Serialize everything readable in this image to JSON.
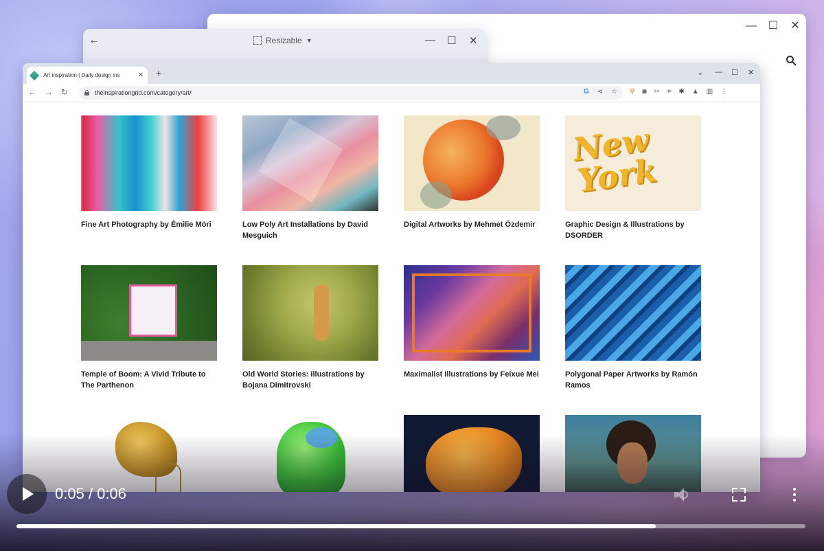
{
  "back_window": {
    "controls": {
      "minimize": "—",
      "maximize": "☐",
      "close": "✕"
    },
    "search_icon": "search-icon"
  },
  "mid_window": {
    "back_icon": "←",
    "resize_label": "Resizable",
    "resize_caret": "▼",
    "controls": {
      "minimize": "—",
      "maximize": "☐",
      "close": "✕"
    }
  },
  "browser": {
    "tab": {
      "title": "Art inspiration | Daily design ins",
      "close": "✕"
    },
    "new_tab": "+",
    "window_controls": {
      "chevron": "⌄",
      "minimize": "—",
      "maximize": "☐",
      "close": "✕"
    },
    "nav": {
      "back": "←",
      "forward": "→",
      "reload": "↻"
    },
    "url": "theinspirationgrid.com/category/art/",
    "omnibox_icons": [
      "G",
      "⋖",
      "☆"
    ],
    "extension_icons": [
      "⚲",
      "◙",
      "✂",
      "⌗",
      "✱",
      "▲",
      "▥",
      "⋮"
    ]
  },
  "cards": [
    {
      "title": "Fine Art Photography by Émilie Möri"
    },
    {
      "title": "Low Poly Art Installations by David Mesguich"
    },
    {
      "title": "Digital Artworks by Mehmet Özdemir"
    },
    {
      "title": "Graphic Design & Illustrations by DSORDER",
      "thumb_text": "New York"
    },
    {
      "title": "Temple of Boom: A Vivid Tribute to The Parthenon"
    },
    {
      "title": "Old World Stories: Illustrations by Bojana Dimitrovski"
    },
    {
      "title": "Maximalist Illustrations by Feixue Mei"
    },
    {
      "title": "Polygonal Paper Artworks by Ramón Ramos"
    },
    {
      "title": ""
    },
    {
      "title": ""
    },
    {
      "title": ""
    },
    {
      "title": ""
    }
  ],
  "video": {
    "current_time": "0:05",
    "separator": " / ",
    "duration": "0:06",
    "progress_fraction": 0.81,
    "icons": [
      "play-icon",
      "volume-icon",
      "fullscreen-icon",
      "more-vert-icon"
    ]
  }
}
